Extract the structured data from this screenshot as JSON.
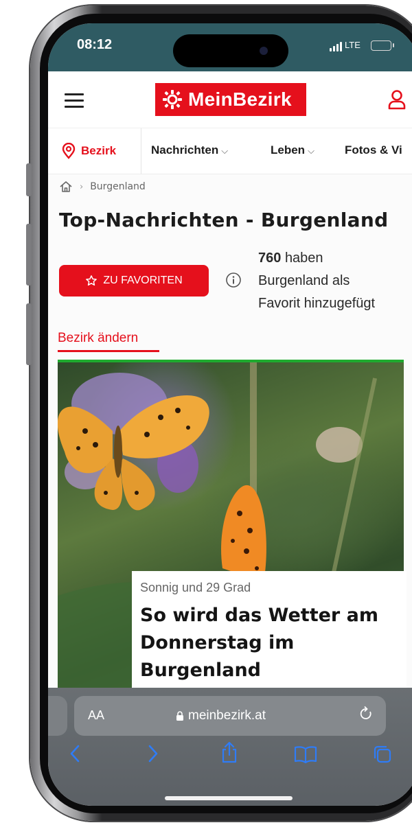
{
  "status": {
    "time": "08:12",
    "network": "LTE"
  },
  "header": {
    "logo_text": "MeinBezirk",
    "brand_color": "#e5101c"
  },
  "nav": {
    "bezirk_label": "Bezirk",
    "items": [
      "Nachrichten",
      "Leben",
      "Fotos & Vi"
    ]
  },
  "breadcrumb": {
    "current": "Burgenland"
  },
  "page": {
    "title": "Top-Nachrichten - Burgenland",
    "favorite_button": "ZU FAVORITEN",
    "fav_count": "760",
    "fav_text_1": "haben",
    "fav_text_2": "Burgenland als",
    "fav_text_3": "Favorit hinzugefügt",
    "change_link": "Bezirk ändern"
  },
  "article": {
    "kicker": "Sonnig und 29 Grad",
    "headline": "So wird das Wetter am Donnerstag im Burgenland"
  },
  "browser": {
    "aa": "AA",
    "url": "meinbezirk.at",
    "accent_color": "#2f7cf6"
  },
  "icons": [
    "menu-icon",
    "logo-sun-icon",
    "user-icon",
    "location-pin-icon",
    "home-icon",
    "star-icon",
    "info-icon",
    "lock-icon",
    "reload-icon",
    "back-icon",
    "forward-icon",
    "share-icon",
    "bookmarks-icon",
    "tabs-icon",
    "butterfly-photo"
  ]
}
